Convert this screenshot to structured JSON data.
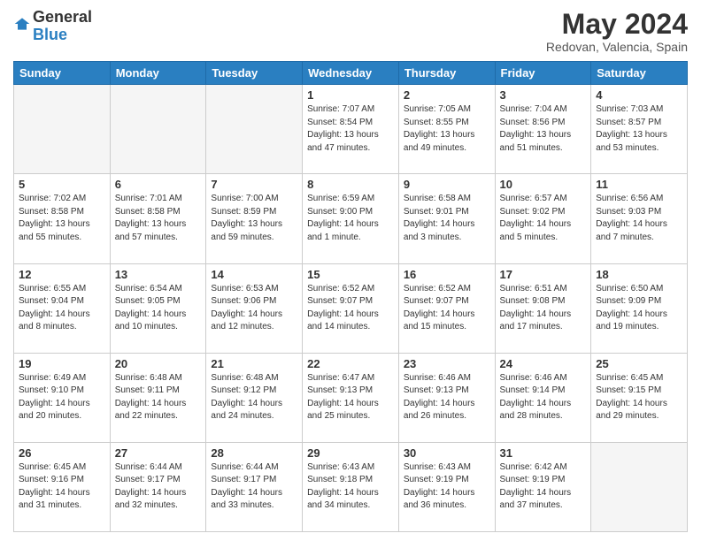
{
  "header": {
    "logo_line1": "General",
    "logo_line2": "Blue",
    "title": "May 2024",
    "subtitle": "Redovan, Valencia, Spain"
  },
  "weekdays": [
    "Sunday",
    "Monday",
    "Tuesday",
    "Wednesday",
    "Thursday",
    "Friday",
    "Saturday"
  ],
  "weeks": [
    [
      {
        "day": "",
        "info": ""
      },
      {
        "day": "",
        "info": ""
      },
      {
        "day": "",
        "info": ""
      },
      {
        "day": "1",
        "info": "Sunrise: 7:07 AM\nSunset: 8:54 PM\nDaylight: 13 hours\nand 47 minutes."
      },
      {
        "day": "2",
        "info": "Sunrise: 7:05 AM\nSunset: 8:55 PM\nDaylight: 13 hours\nand 49 minutes."
      },
      {
        "day": "3",
        "info": "Sunrise: 7:04 AM\nSunset: 8:56 PM\nDaylight: 13 hours\nand 51 minutes."
      },
      {
        "day": "4",
        "info": "Sunrise: 7:03 AM\nSunset: 8:57 PM\nDaylight: 13 hours\nand 53 minutes."
      }
    ],
    [
      {
        "day": "5",
        "info": "Sunrise: 7:02 AM\nSunset: 8:58 PM\nDaylight: 13 hours\nand 55 minutes."
      },
      {
        "day": "6",
        "info": "Sunrise: 7:01 AM\nSunset: 8:58 PM\nDaylight: 13 hours\nand 57 minutes."
      },
      {
        "day": "7",
        "info": "Sunrise: 7:00 AM\nSunset: 8:59 PM\nDaylight: 13 hours\nand 59 minutes."
      },
      {
        "day": "8",
        "info": "Sunrise: 6:59 AM\nSunset: 9:00 PM\nDaylight: 14 hours\nand 1 minute."
      },
      {
        "day": "9",
        "info": "Sunrise: 6:58 AM\nSunset: 9:01 PM\nDaylight: 14 hours\nand 3 minutes."
      },
      {
        "day": "10",
        "info": "Sunrise: 6:57 AM\nSunset: 9:02 PM\nDaylight: 14 hours\nand 5 minutes."
      },
      {
        "day": "11",
        "info": "Sunrise: 6:56 AM\nSunset: 9:03 PM\nDaylight: 14 hours\nand 7 minutes."
      }
    ],
    [
      {
        "day": "12",
        "info": "Sunrise: 6:55 AM\nSunset: 9:04 PM\nDaylight: 14 hours\nand 8 minutes."
      },
      {
        "day": "13",
        "info": "Sunrise: 6:54 AM\nSunset: 9:05 PM\nDaylight: 14 hours\nand 10 minutes."
      },
      {
        "day": "14",
        "info": "Sunrise: 6:53 AM\nSunset: 9:06 PM\nDaylight: 14 hours\nand 12 minutes."
      },
      {
        "day": "15",
        "info": "Sunrise: 6:52 AM\nSunset: 9:07 PM\nDaylight: 14 hours\nand 14 minutes."
      },
      {
        "day": "16",
        "info": "Sunrise: 6:52 AM\nSunset: 9:07 PM\nDaylight: 14 hours\nand 15 minutes."
      },
      {
        "day": "17",
        "info": "Sunrise: 6:51 AM\nSunset: 9:08 PM\nDaylight: 14 hours\nand 17 minutes."
      },
      {
        "day": "18",
        "info": "Sunrise: 6:50 AM\nSunset: 9:09 PM\nDaylight: 14 hours\nand 19 minutes."
      }
    ],
    [
      {
        "day": "19",
        "info": "Sunrise: 6:49 AM\nSunset: 9:10 PM\nDaylight: 14 hours\nand 20 minutes."
      },
      {
        "day": "20",
        "info": "Sunrise: 6:48 AM\nSunset: 9:11 PM\nDaylight: 14 hours\nand 22 minutes."
      },
      {
        "day": "21",
        "info": "Sunrise: 6:48 AM\nSunset: 9:12 PM\nDaylight: 14 hours\nand 24 minutes."
      },
      {
        "day": "22",
        "info": "Sunrise: 6:47 AM\nSunset: 9:13 PM\nDaylight: 14 hours\nand 25 minutes."
      },
      {
        "day": "23",
        "info": "Sunrise: 6:46 AM\nSunset: 9:13 PM\nDaylight: 14 hours\nand 26 minutes."
      },
      {
        "day": "24",
        "info": "Sunrise: 6:46 AM\nSunset: 9:14 PM\nDaylight: 14 hours\nand 28 minutes."
      },
      {
        "day": "25",
        "info": "Sunrise: 6:45 AM\nSunset: 9:15 PM\nDaylight: 14 hours\nand 29 minutes."
      }
    ],
    [
      {
        "day": "26",
        "info": "Sunrise: 6:45 AM\nSunset: 9:16 PM\nDaylight: 14 hours\nand 31 minutes."
      },
      {
        "day": "27",
        "info": "Sunrise: 6:44 AM\nSunset: 9:17 PM\nDaylight: 14 hours\nand 32 minutes."
      },
      {
        "day": "28",
        "info": "Sunrise: 6:44 AM\nSunset: 9:17 PM\nDaylight: 14 hours\nand 33 minutes."
      },
      {
        "day": "29",
        "info": "Sunrise: 6:43 AM\nSunset: 9:18 PM\nDaylight: 14 hours\nand 34 minutes."
      },
      {
        "day": "30",
        "info": "Sunrise: 6:43 AM\nSunset: 9:19 PM\nDaylight: 14 hours\nand 36 minutes."
      },
      {
        "day": "31",
        "info": "Sunrise: 6:42 AM\nSunset: 9:19 PM\nDaylight: 14 hours\nand 37 minutes."
      },
      {
        "day": "",
        "info": ""
      }
    ]
  ]
}
